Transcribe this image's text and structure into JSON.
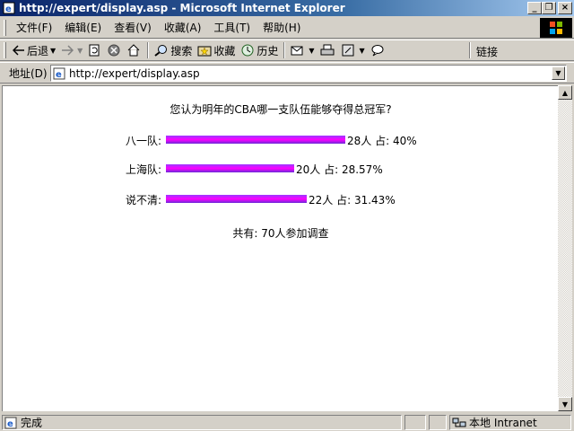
{
  "window": {
    "title": "http://expert/display.asp - Microsoft Internet Explorer",
    "minimize": "_",
    "maximize": "❐",
    "close": "×"
  },
  "menu": {
    "items": [
      "文件(F)",
      "编辑(E)",
      "查看(V)",
      "收藏(A)",
      "工具(T)",
      "帮助(H)"
    ]
  },
  "toolbar": {
    "back_label": "后退",
    "search_label": "搜索",
    "favorites_label": "收藏",
    "history_label": "历史",
    "links_label": "链接"
  },
  "address": {
    "label": "地址(D)",
    "url": "http://expert/display.asp"
  },
  "poll": {
    "question": "您认为明年的CBA哪一支队伍能够夺得总冠军?",
    "options": [
      {
        "label": "八一队:",
        "count_text": "28人",
        "share_text": "占: 40%",
        "percent": 40
      },
      {
        "label": "上海队:",
        "count_text": "20人",
        "share_text": "占: 28.57%",
        "percent": 28.57
      },
      {
        "label": "说不清:",
        "count_text": "22人",
        "share_text": "占: 31.43%",
        "percent": 31.43
      }
    ],
    "total": "共有: 70人参加调查"
  },
  "status": {
    "text": "完成",
    "zone": "本地 Intranet"
  },
  "colors": {
    "bar_gradient": [
      "#9a38ff",
      "#ff00ff",
      "#6a2ad8"
    ]
  }
}
